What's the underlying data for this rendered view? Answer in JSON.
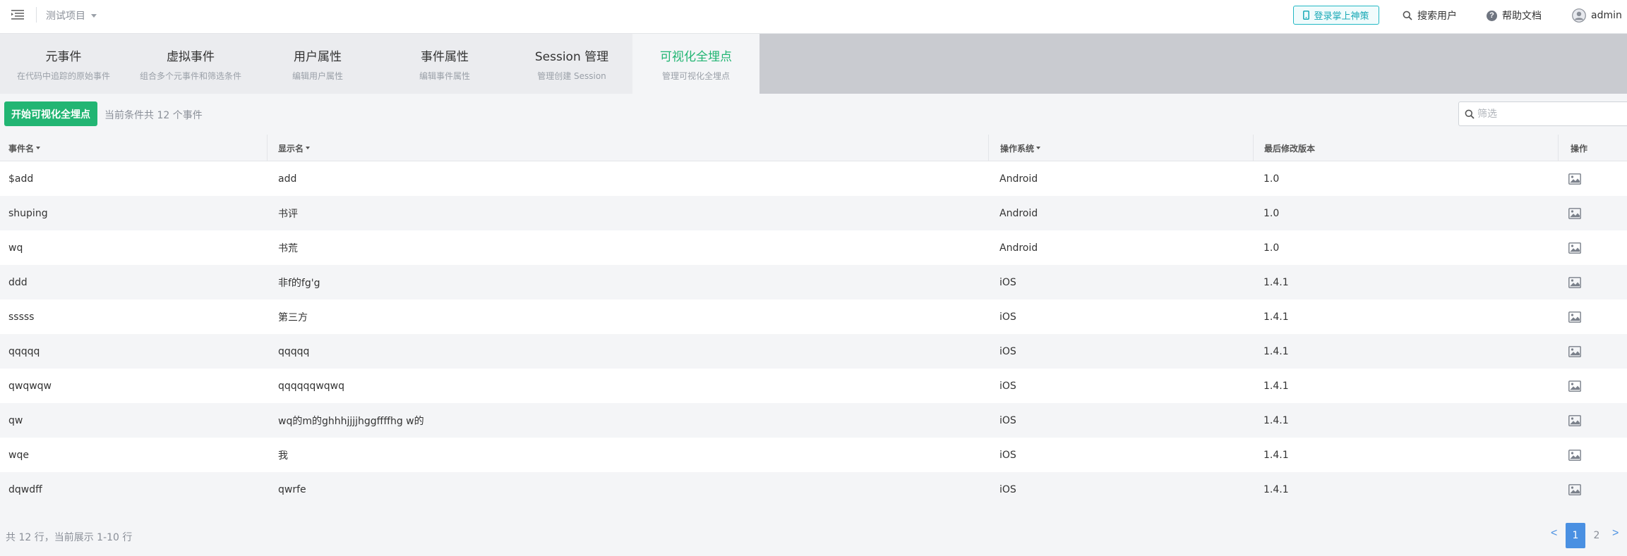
{
  "header": {
    "project": "测试项目",
    "mobile_login": "登录掌上神策",
    "search_users": "搜索用户",
    "help_docs": "帮助文档",
    "user": "admin"
  },
  "tabs": [
    {
      "title": "元事件",
      "sub": "在代码中追踪的原始事件"
    },
    {
      "title": "虚拟事件",
      "sub": "组合多个元事件和筛选条件"
    },
    {
      "title": "用户属性",
      "sub": "编辑用户属性"
    },
    {
      "title": "事件属性",
      "sub": "编辑事件属性"
    },
    {
      "title": "Session 管理",
      "sub": "管理创建 Session"
    },
    {
      "title": "可视化全埋点",
      "sub": "管理可视化全埋点"
    }
  ],
  "toolbar": {
    "start_button": "开始可视化全埋点",
    "count_text": "当前条件共 12 个事件",
    "filter_placeholder": "筛选"
  },
  "table": {
    "columns": [
      "事件名",
      "显示名",
      "操作系统",
      "最后修改版本",
      "操作"
    ],
    "rows": [
      {
        "event": "$add",
        "display": "add",
        "os": "Android",
        "version": "1.0"
      },
      {
        "event": "shuping",
        "display": "书评",
        "os": "Android",
        "version": "1.0"
      },
      {
        "event": "wq",
        "display": "书荒",
        "os": "Android",
        "version": "1.0"
      },
      {
        "event": "ddd",
        "display": "非f的fg'g",
        "os": "iOS",
        "version": "1.4.1"
      },
      {
        "event": "sssss",
        "display": "第三方",
        "os": "iOS",
        "version": "1.4.1"
      },
      {
        "event": "qqqqq",
        "display": "qqqqq",
        "os": "iOS",
        "version": "1.4.1"
      },
      {
        "event": "qwqwqw",
        "display": "qqqqqqwqwq",
        "os": "iOS",
        "version": "1.4.1"
      },
      {
        "event": "qw",
        "display": "wq的m的ghhhjjjjhggffffhg w的",
        "os": "iOS",
        "version": "1.4.1"
      },
      {
        "event": "wqe",
        "display": "我",
        "os": "iOS",
        "version": "1.4.1"
      },
      {
        "event": "dqwdff",
        "display": "qwrfe",
        "os": "iOS",
        "version": "1.4.1"
      }
    ]
  },
  "footer": {
    "summary": "共 12 行，当前展示 1-10 行",
    "prev": "<",
    "pages": [
      "1",
      "2"
    ],
    "next": ">"
  },
  "colors": {
    "accent_green": "#22b573",
    "link_blue": "#4a90e2",
    "teal": "#1aa9b6"
  },
  "icons": [
    "menu-icon",
    "mobile-icon",
    "search-icon",
    "help-icon",
    "user-avatar-icon",
    "image-icon"
  ]
}
